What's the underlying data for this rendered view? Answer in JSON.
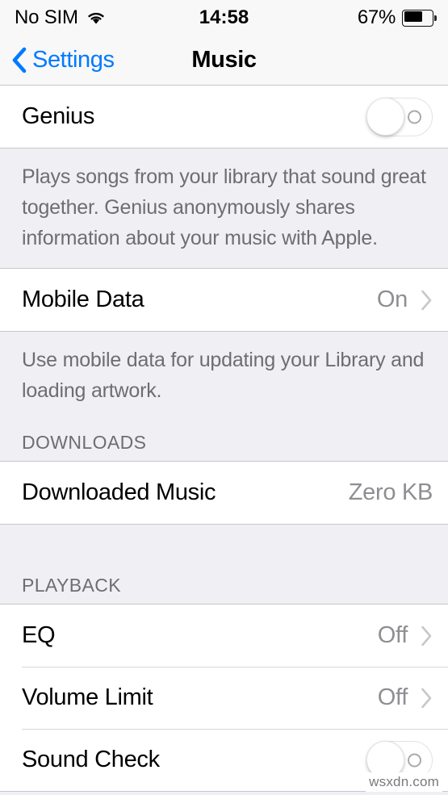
{
  "status_bar": {
    "carrier": "No SIM",
    "wifi_icon": "wifi-icon",
    "time": "14:58",
    "battery_percent_label": "67%",
    "battery_level": 67,
    "battery_icon": "battery-icon"
  },
  "nav_bar": {
    "back_icon": "chevron-left-icon",
    "back_label": "Settings",
    "title": "Music"
  },
  "sections": {
    "genius": {
      "row_label": "Genius",
      "toggle_state": "off",
      "footer": "Plays songs from your library that sound great together. Genius anonymously shares information about your music with Apple."
    },
    "mobile_data": {
      "row_label": "Mobile Data",
      "value": "On",
      "chevron_icon": "chevron-right-icon",
      "footer": "Use mobile data for updating your Library and loading artwork."
    },
    "downloads": {
      "header": "DOWNLOADS",
      "row_label": "Downloaded Music",
      "value": "Zero KB"
    },
    "playback": {
      "header": "PLAYBACK",
      "rows": [
        {
          "label": "EQ",
          "value": "Off",
          "type": "disclosure"
        },
        {
          "label": "Volume Limit",
          "value": "Off",
          "type": "disclosure"
        },
        {
          "label": "Sound Check",
          "value": "",
          "type": "toggle",
          "toggle_state": "off"
        }
      ]
    }
  },
  "watermark": "wsxdn.com",
  "colors": {
    "accent_blue": "#007aff",
    "grouped_background": "#efeff4",
    "row_background": "#ffffff",
    "separator": "#c8c7cc",
    "secondary_text": "#8e8e93",
    "footer_text": "#6d6d72"
  }
}
